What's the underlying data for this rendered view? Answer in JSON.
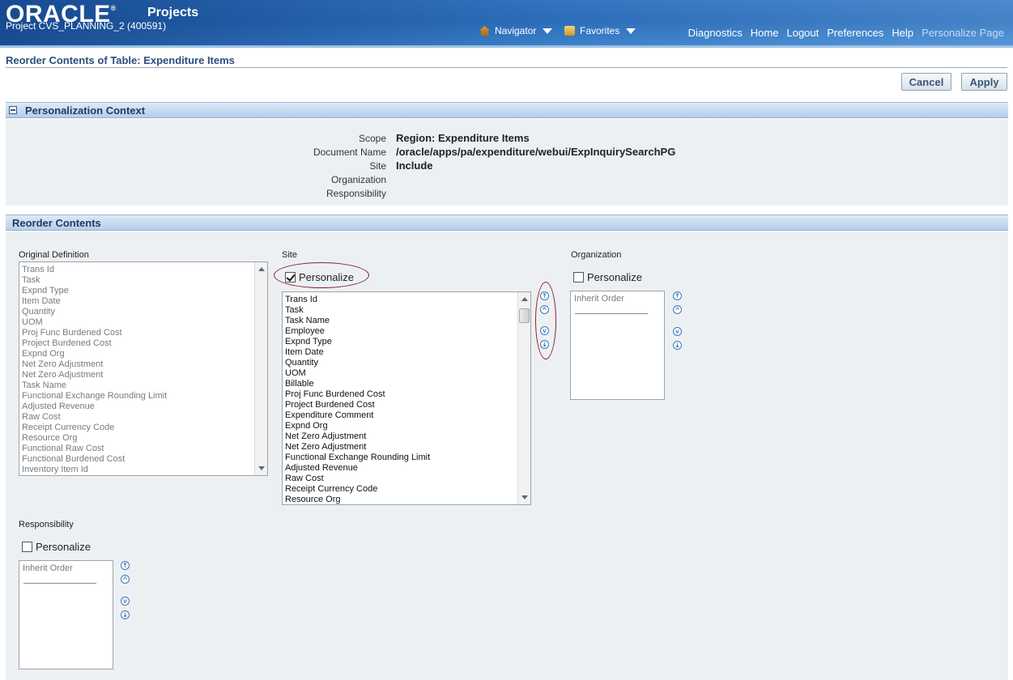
{
  "header": {
    "logo": "ORACLE",
    "app_title": "Projects",
    "project": "Project CVS_PLANNING_2 (400591)",
    "navigator": "Navigator",
    "favorites": "Favorites",
    "links": [
      "Diagnostics",
      "Home",
      "Logout",
      "Preferences",
      "Help",
      "Personalize Page"
    ]
  },
  "page": {
    "title": "Reorder Contents of Table: Expenditure Items",
    "cancel": "Cancel",
    "apply": "Apply"
  },
  "context": {
    "section_title": "Personalization Context",
    "labels": [
      "Scope",
      "Document Name",
      "Site",
      "Organization",
      "Responsibility"
    ],
    "values": {
      "scope": "Region: Expenditure Items",
      "document_name": "/oracle/apps/pa/expenditure/webui/ExpInquirySearchPG",
      "site": "Include",
      "organization": "",
      "responsibility": ""
    }
  },
  "reorder": {
    "section_title": "Reorder Contents",
    "original_label": "Original Definition",
    "original_items": [
      "Trans Id",
      "Task",
      "Expnd Type",
      "Item Date",
      "Quantity",
      "UOM",
      "Proj Func Burdened Cost",
      "Project Burdened Cost",
      "Expnd Org",
      "Net Zero Adjustment",
      "Net Zero Adjustment",
      "Task Name",
      "Functional Exchange Rounding Limit",
      "Adjusted Revenue",
      "Raw Cost",
      "Receipt Currency Code",
      "Resource Org",
      "Functional Raw Cost",
      "Functional Burdened Cost",
      "Inventory Item Id"
    ],
    "site_label": "Site",
    "site_personalize": "Personalize",
    "site_personalize_checked": true,
    "site_items": [
      "Trans Id",
      "Task",
      "Task Name",
      "Employee",
      "Expnd Type",
      "Item Date",
      "Quantity",
      "UOM",
      "Billable",
      "Proj Func Burdened Cost",
      "Project Burdened Cost",
      "Expenditure Comment",
      "Expnd Org",
      "Net Zero Adjustment",
      "Net Zero Adjustment",
      "Functional Exchange Rounding Limit",
      "Adjusted Revenue",
      "Raw Cost",
      "Receipt Currency Code",
      "Resource Org"
    ],
    "org_label": "Organization",
    "org_personalize": "Personalize",
    "org_personalize_checked": false,
    "org_items": [
      "Inherit Order"
    ],
    "resp_label": "Responsibility",
    "resp_personalize": "Personalize",
    "resp_personalize_checked": false,
    "resp_items": [
      "Inherit Order"
    ]
  }
}
